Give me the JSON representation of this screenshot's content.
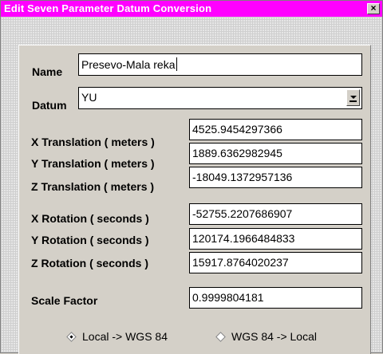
{
  "window": {
    "title": "Edit Seven Parameter Datum Conversion",
    "close_glyph": "×"
  },
  "form": {
    "name_label": "Name",
    "name_value": "Presevo-Mala reka",
    "datum_label": "Datum",
    "datum_value": "YU",
    "x_translation_label": "X Translation ( meters )",
    "x_translation_value": "4525.9454297366",
    "y_translation_label": "Y Translation ( meters )",
    "y_translation_value": "1889.6362982945",
    "z_translation_label": "Z Translation ( meters )",
    "z_translation_value": "-18049.1372957136",
    "x_rotation_label": "X Rotation ( seconds )",
    "x_rotation_value": "-52755.2207686907",
    "y_rotation_label": "Y Rotation ( seconds )",
    "y_rotation_value": "120174.1966484833",
    "z_rotation_label": "Z Rotation ( seconds )",
    "z_rotation_value": "15917.8764020237",
    "scale_factor_label": "Scale Factor",
    "scale_factor_value": "0.9999804181"
  },
  "direction": {
    "options": [
      {
        "label": "Local -> WGS 84",
        "selected": true
      },
      {
        "label": "WGS 84 -> Local",
        "selected": false
      }
    ]
  },
  "colors": {
    "titlebar": "#ff00ff",
    "dialog": "#d4d0c8"
  }
}
